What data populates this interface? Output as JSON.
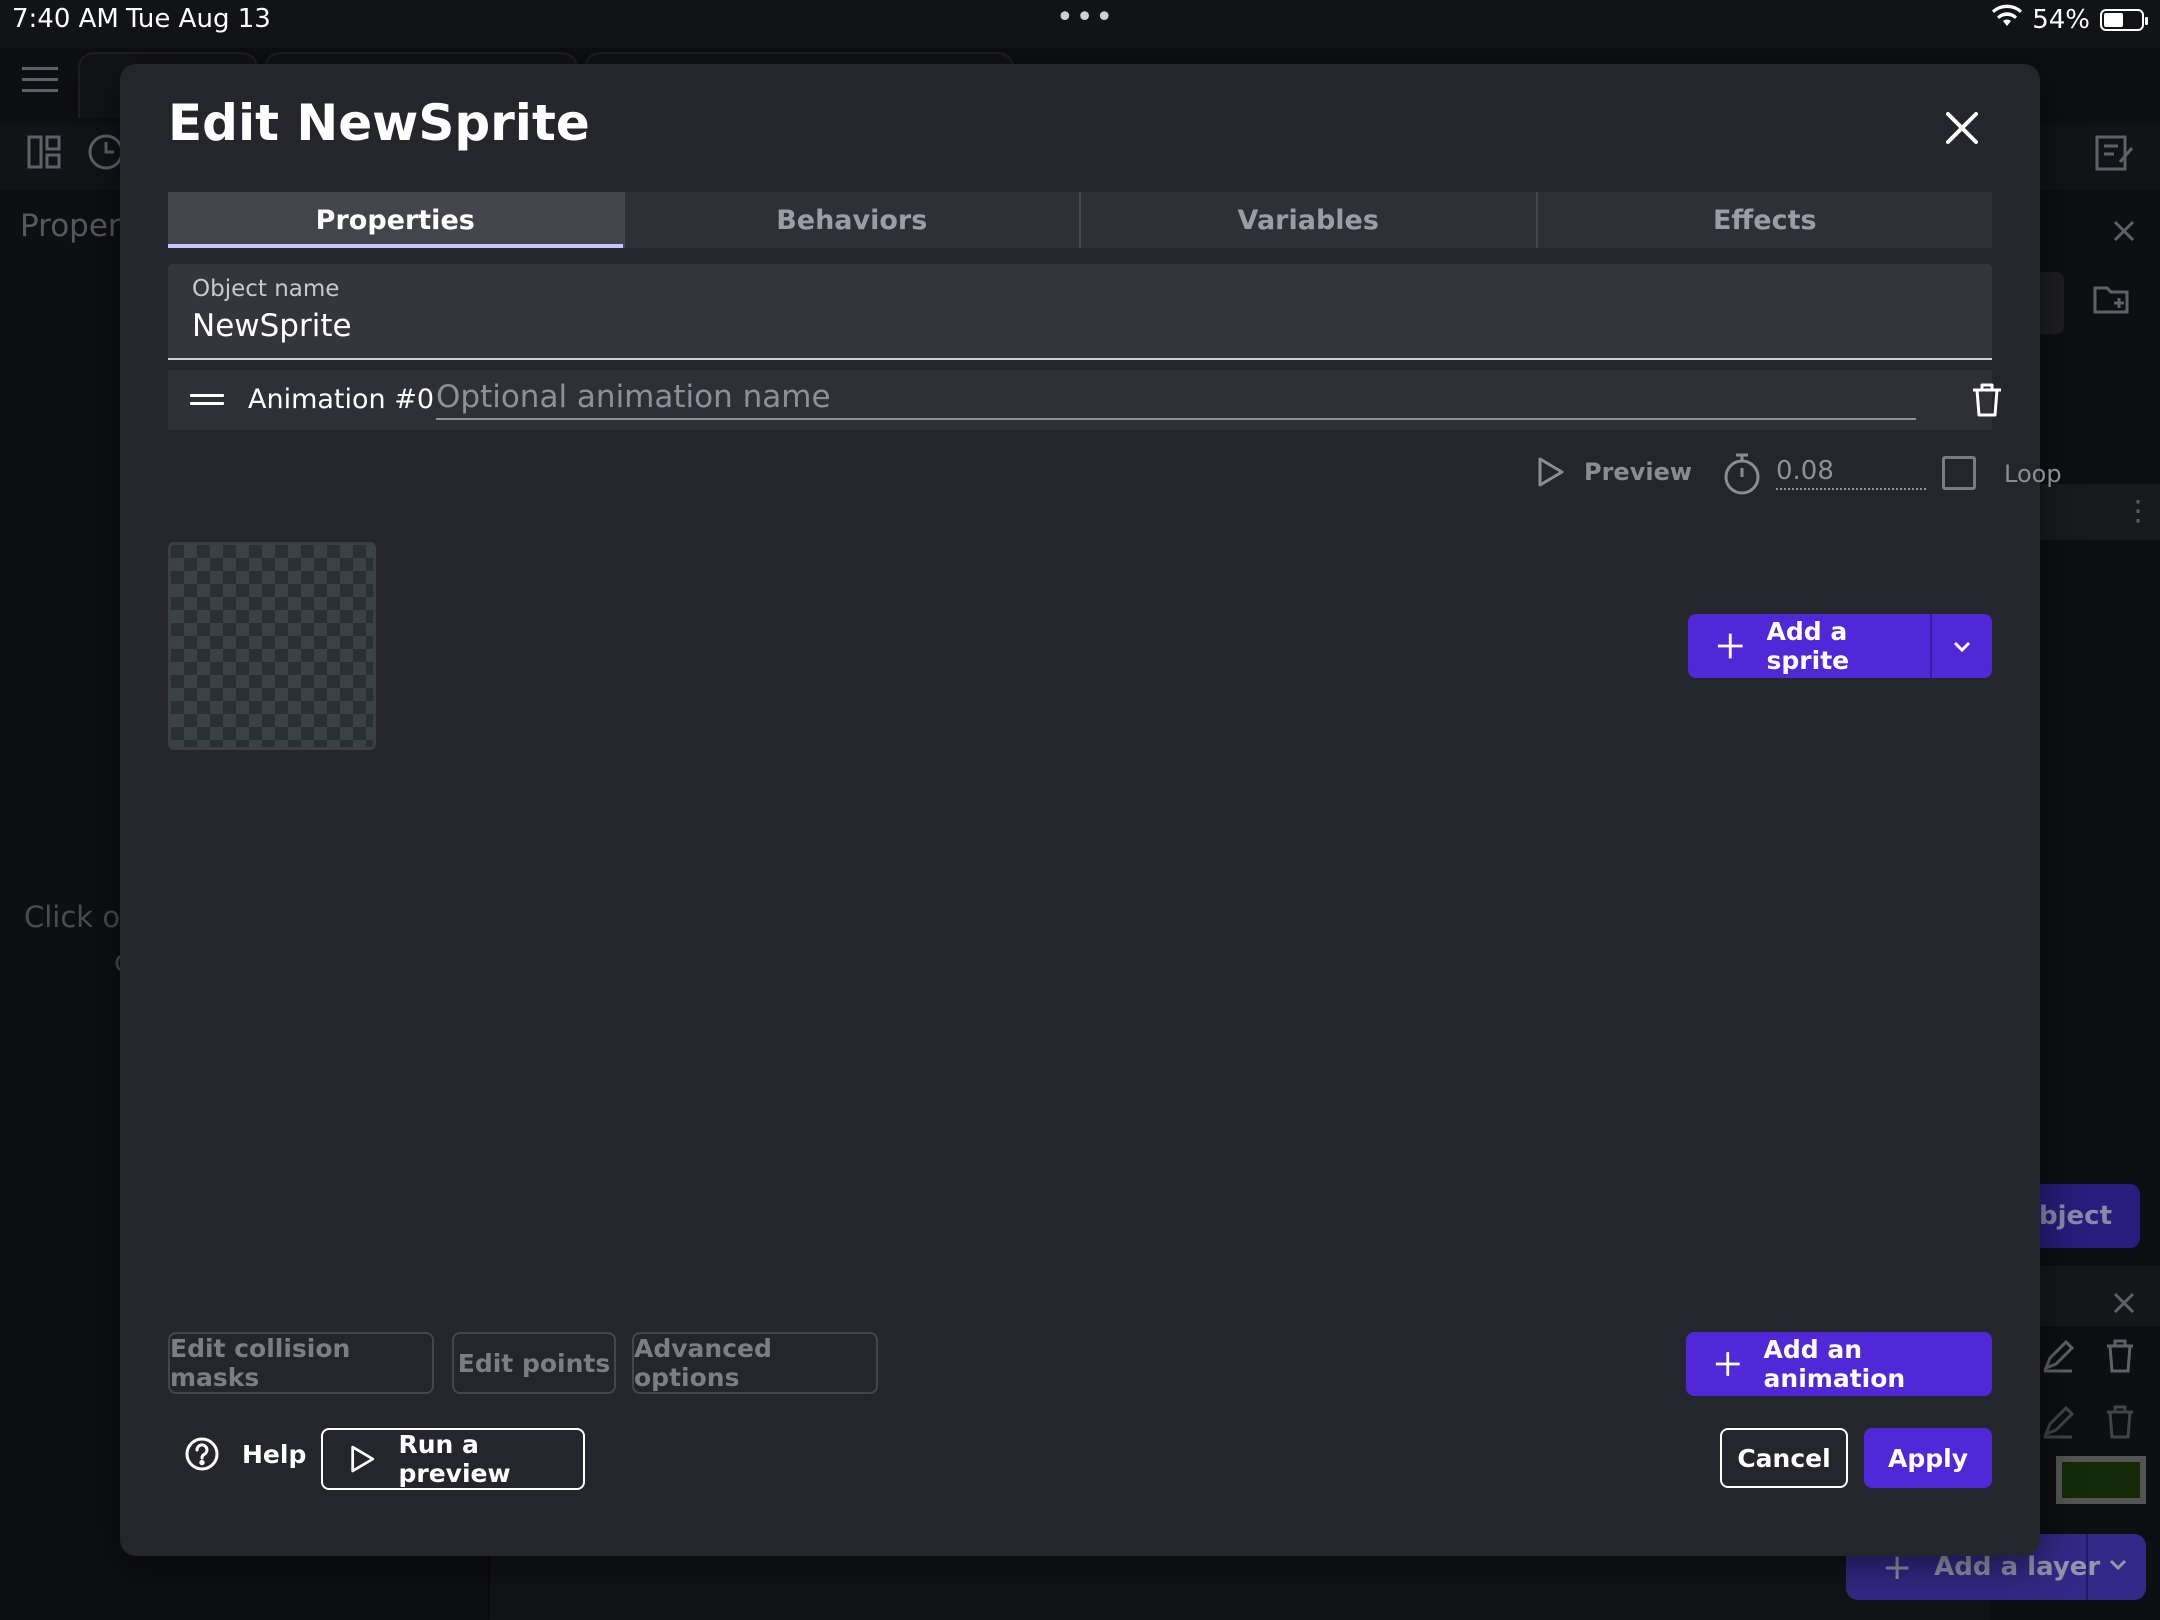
{
  "status_bar": {
    "time": "7:40 AM",
    "date": "Tue Aug 13",
    "battery": "54%",
    "battery_level": 0.54
  },
  "background": {
    "left_panel_title": "Propert",
    "left_panel_hint_line1": "Click on",
    "left_panel_hint_line2": "c",
    "right_object_button": "bject",
    "add_layer_label": "Add a layer",
    "swatch_color": "#1e3d0c"
  },
  "dialog": {
    "title": "Edit NewSprite",
    "tabs": [
      "Properties",
      "Behaviors",
      "Variables",
      "Effects"
    ],
    "active_tab": "Properties",
    "object_name": {
      "label": "Object name",
      "value": "NewSprite"
    },
    "animation": {
      "label": "Animation #0",
      "name_placeholder": "Optional animation name",
      "preview_label": "Preview",
      "timing": "0.08",
      "loop_label": "Loop",
      "loop_checked": false
    },
    "add_sprite_label": "Add a sprite",
    "secondary_buttons": {
      "collision": "Edit collision masks",
      "points": "Edit points",
      "advanced": "Advanced options"
    },
    "add_animation_label": "Add an animation",
    "footer": {
      "help": "Help",
      "run_preview": "Run a preview",
      "cancel": "Cancel",
      "apply": "Apply"
    }
  },
  "colors": {
    "accent": "#5128d8",
    "dialog_bg": "#25262c",
    "tab_active_underline": "#c9c4ff"
  }
}
